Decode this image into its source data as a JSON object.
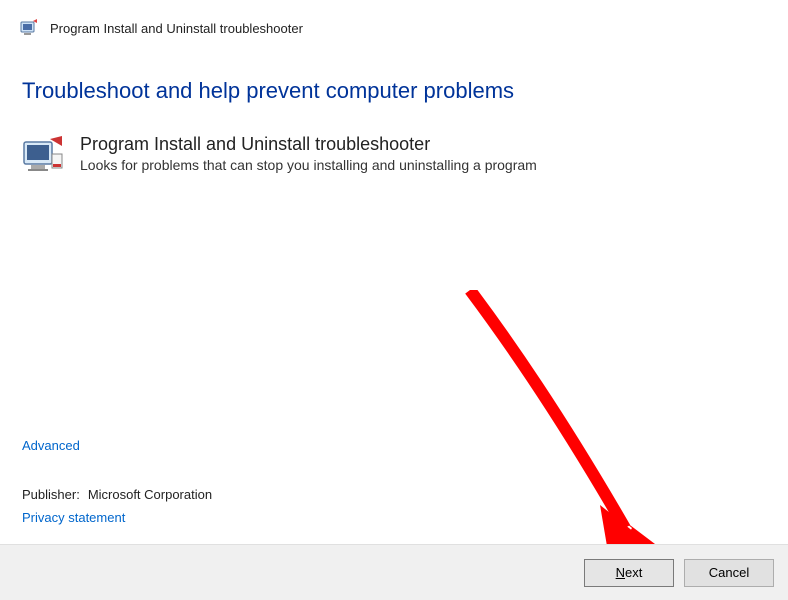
{
  "window": {
    "title": "Program Install and Uninstall troubleshooter"
  },
  "heading": "Troubleshoot and help prevent computer problems",
  "troubleshooter": {
    "title": "Program Install and Uninstall troubleshooter",
    "description": "Looks for problems that can stop you installing and uninstalling a program"
  },
  "links": {
    "advanced": "Advanced",
    "privacy": "Privacy statement"
  },
  "publisher": {
    "label": "Publisher:",
    "name": "Microsoft Corporation"
  },
  "buttons": {
    "next_prefix": "N",
    "next_rest": "ext",
    "cancel": "Cancel"
  }
}
